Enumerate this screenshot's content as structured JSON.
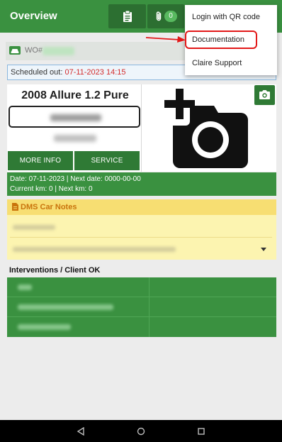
{
  "app": {
    "title": "Overview"
  },
  "toolbar": {
    "docs_icon": "clipboard-icon",
    "attachments_icon": "paperclip-icon",
    "attachments_count": "0"
  },
  "work_order": {
    "label": "WO#"
  },
  "schedule": {
    "label": "Scheduled out:",
    "value": "07-11-2023 14:15"
  },
  "vehicle": {
    "title": "2008 Allure 1.2 Pure",
    "more_info_label": "MORE INFO",
    "service_label": "SERVICE"
  },
  "info": {
    "line1": "Date: 07-11-2023 | Next date: 0000-00-00",
    "line2": "Current km: 0 | Next km: 0"
  },
  "notes": {
    "title": "DMS Car Notes"
  },
  "interventions": {
    "title": "Interventions / Client OK"
  },
  "menu": {
    "items": [
      {
        "label": "Login with QR code"
      },
      {
        "label": "Documentation"
      },
      {
        "label": "Claire Support"
      }
    ]
  },
  "colors": {
    "primary": "#3a9140",
    "primary_dark": "#2c6f31",
    "notes_header": "#f7de72",
    "notes_body": "#fcf4b0",
    "highlight": "#e21818",
    "scheduled_value": "#d42d2d"
  }
}
